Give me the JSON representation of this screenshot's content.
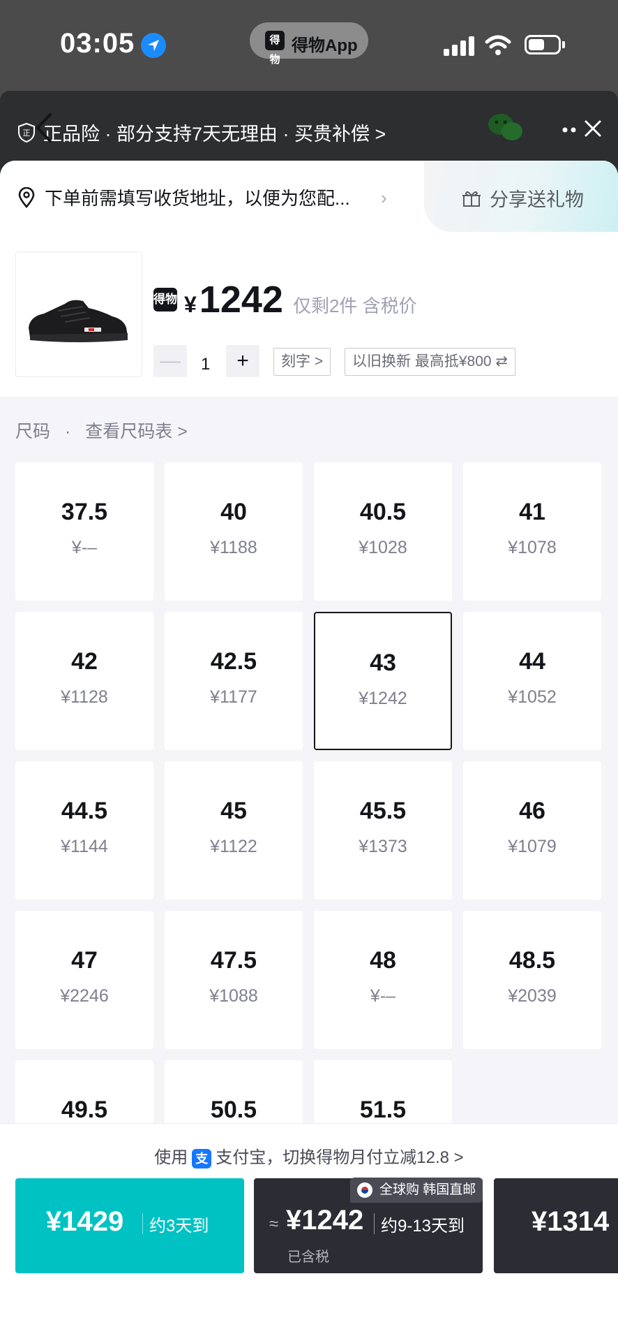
{
  "status_bar": {
    "time": "03:05",
    "app_pill": "得物App",
    "app_logo": "得物"
  },
  "header": {
    "guarantee_text": "正品险 · 部分支持7天无理由 · 买贵补偿 >"
  },
  "address": {
    "text": "下单前需填写收货地址，以便为您配..."
  },
  "share": {
    "label": "分享送礼物"
  },
  "product": {
    "brand_logo": "得物",
    "currency": "¥",
    "price": "1242",
    "stock_note": "仅剩2件 含税价",
    "quantity": "1",
    "engrave_label": "刻字 >",
    "tradein_label": "以旧换新 最高抵¥800 ⇄"
  },
  "size_section": {
    "title": "尺码",
    "chart_link": "查看尺码表 >"
  },
  "sizes": [
    {
      "size": "37.5",
      "price": "¥-–"
    },
    {
      "size": "40",
      "price": "¥1188"
    },
    {
      "size": "40.5",
      "price": "¥1028"
    },
    {
      "size": "41",
      "price": "¥1078"
    },
    {
      "size": "42",
      "price": "¥1128"
    },
    {
      "size": "42.5",
      "price": "¥1177"
    },
    {
      "size": "43",
      "price": "¥1242",
      "selected": true
    },
    {
      "size": "44",
      "price": "¥1052"
    },
    {
      "size": "44.5",
      "price": "¥1144"
    },
    {
      "size": "45",
      "price": "¥1122"
    },
    {
      "size": "45.5",
      "price": "¥1373"
    },
    {
      "size": "46",
      "price": "¥1079"
    },
    {
      "size": "47",
      "price": "¥2246"
    },
    {
      "size": "47.5",
      "price": "¥1088"
    },
    {
      "size": "48",
      "price": "¥-–"
    },
    {
      "size": "48.5",
      "price": "¥2039"
    },
    {
      "size": "49.5",
      "price": ""
    },
    {
      "size": "50.5",
      "price": ""
    },
    {
      "size": "51.5",
      "price": ""
    }
  ],
  "bottom": {
    "promo_prefix": "使用",
    "promo_icon": "支",
    "promo_suffix": "支付宝，切换得物月付立减12.8 >",
    "option1": {
      "price": "¥1429",
      "eta": "约3天到"
    },
    "option2": {
      "approx": "≈",
      "price": "¥1242",
      "eta": "约9-13天到",
      "sub": "已含税",
      "tag": "全球购 韩国直邮"
    },
    "option3": {
      "price": "¥1314"
    }
  },
  "colors": {
    "accent": "#01c2c3",
    "dark_button": "#2b2c34",
    "header_bg": "#2c2e30"
  }
}
